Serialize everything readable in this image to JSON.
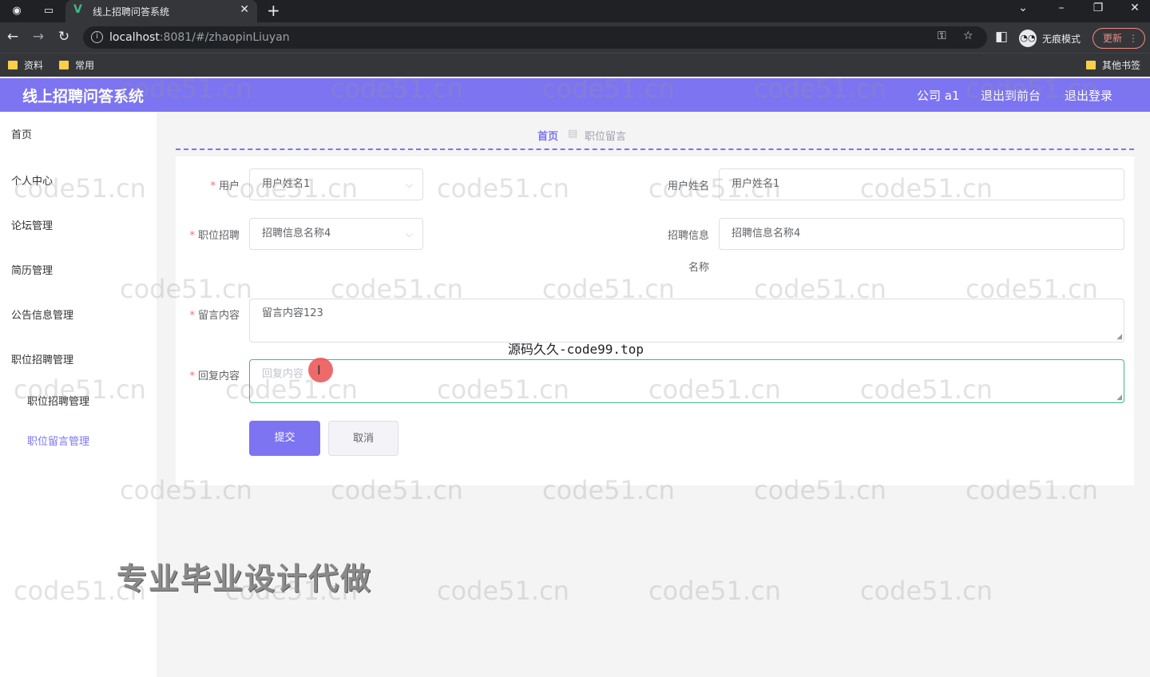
{
  "browser": {
    "tab_title": "线上招聘问答系统",
    "url_host": "localhost",
    "url_rest": ":8081/#/zhaopinLiuyan",
    "incognito_label": "无痕模式",
    "update_label": "更新",
    "bookmarks": [
      "资料",
      "常用"
    ],
    "other_bookmarks": "其他书签"
  },
  "header": {
    "title": "线上招聘问答系统",
    "user": "公司 a1",
    "front": "退出到前台",
    "logout": "退出登录"
  },
  "sidebar": {
    "home": "首页",
    "personal": "个人中心",
    "forum": "论坛管理",
    "resume": "简历管理",
    "notice": "公告信息管理",
    "jobs": "职位招聘管理",
    "jobs_sub": "职位招聘管理",
    "messages_sub": "职位留言管理"
  },
  "breadcrumb": {
    "home": "首页",
    "current": "职位留言"
  },
  "form": {
    "user_label": "用户",
    "user_value": "用户姓名1",
    "username_label": "用户姓名",
    "username_value": "用户姓名1",
    "job_label": "职位招聘",
    "job_value": "招聘信息名称4",
    "jobname_label_1": "招聘信息",
    "jobname_label_2": "名称",
    "jobname_value": "招聘信息名称4",
    "message_label": "留言内容",
    "message_value": "留言内容123",
    "reply_label": "回复内容",
    "reply_placeholder": "回复内容",
    "submit": "提交",
    "cancel": "取消"
  },
  "overlays": {
    "source": "源码久久-code99.top",
    "promo": "专业毕业设计代做",
    "watermark": "code51.cn"
  },
  "colors": {
    "accent": "#7d74f2",
    "required": "#f56c6c",
    "focus": "#42b883"
  }
}
